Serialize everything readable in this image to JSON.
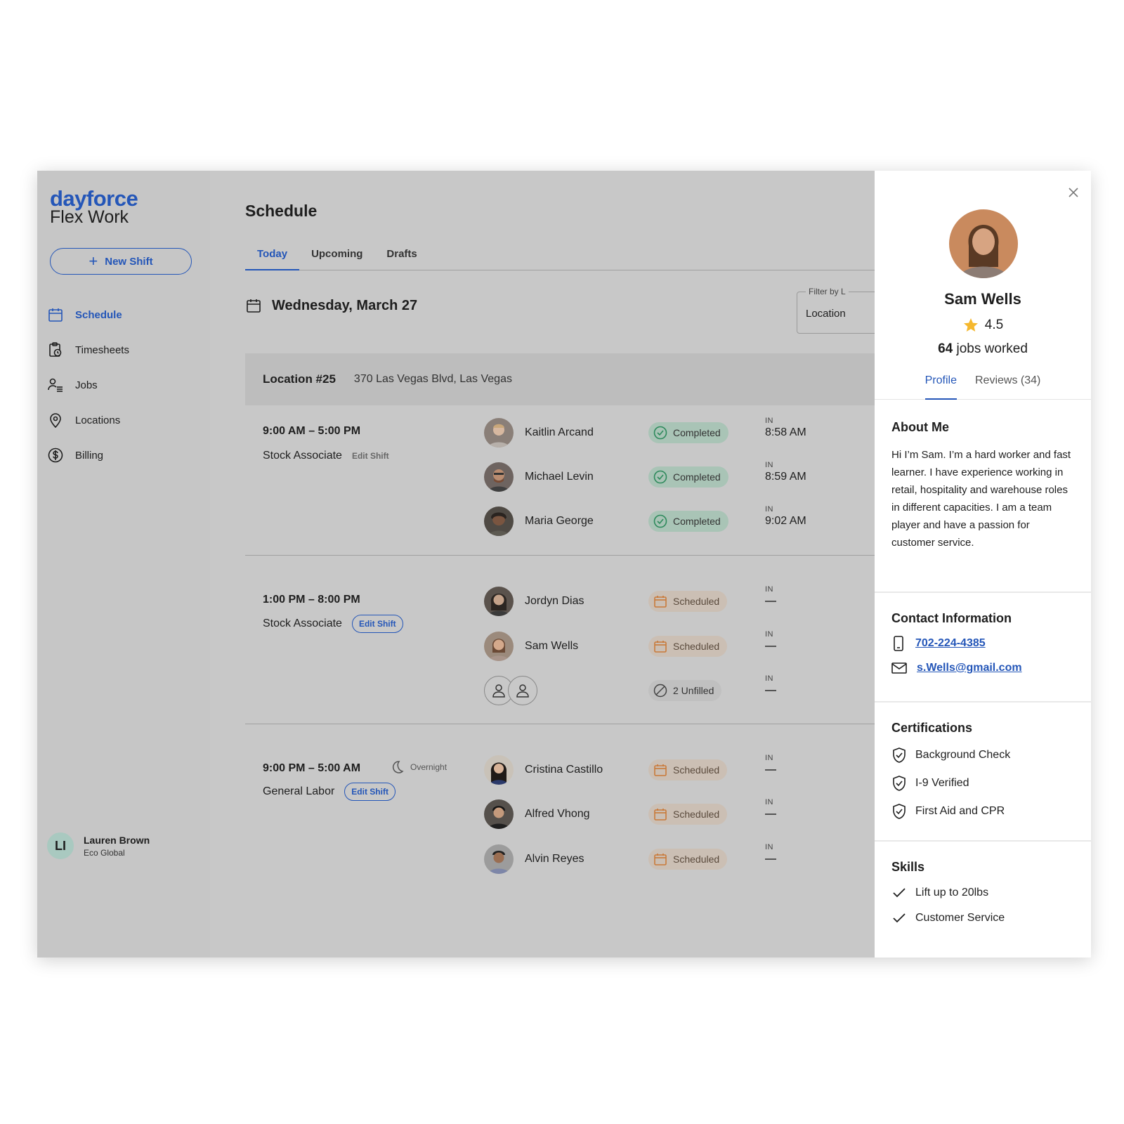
{
  "brand": {
    "top": "dayforce",
    "bottom": "Flex Work"
  },
  "new_shift_label": "New Shift",
  "nav": [
    {
      "label": "Schedule",
      "icon": "calendar-icon",
      "active": true
    },
    {
      "label": "Timesheets",
      "icon": "timesheet-icon",
      "active": false
    },
    {
      "label": "Jobs",
      "icon": "jobs-icon",
      "active": false
    },
    {
      "label": "Locations",
      "icon": "location-pin-icon",
      "active": false
    },
    {
      "label": "Billing",
      "icon": "dollar-icon",
      "active": false
    }
  ],
  "user": {
    "initials": "LI",
    "name": "Lauren Brown",
    "org": "Eco Global"
  },
  "page_title": "Schedule",
  "tabs": [
    "Today",
    "Upcoming",
    "Drafts"
  ],
  "date": "Wednesday, March 27",
  "filter": {
    "label": "Filter by L",
    "value": "Location"
  },
  "location": {
    "name": "Location #25",
    "address": "370 Las Vegas Blvd, Las Vegas"
  },
  "shifts": [
    {
      "time": "9:00 AM – 5:00 PM",
      "role": "Stock Associate",
      "edit_label": "Edit Shift",
      "workers": [
        {
          "name": "Kaitlin Arcand",
          "status": "Completed",
          "in_label": "IN",
          "in_time": "8:58 AM"
        },
        {
          "name": "Michael Levin",
          "status": "Completed",
          "in_label": "IN",
          "in_time": "8:59 AM"
        },
        {
          "name": "Maria George",
          "status": "Completed",
          "in_label": "IN",
          "in_time": "9:02 AM"
        }
      ]
    },
    {
      "time": "1:00 PM – 8:00 PM",
      "role": "Stock Associate",
      "edit_label": "Edit Shift",
      "workers": [
        {
          "name": "Jordyn Dias",
          "status": "Scheduled",
          "in_label": "IN",
          "in_time": ""
        },
        {
          "name": "Sam Wells",
          "status": "Scheduled",
          "in_label": "IN",
          "in_time": ""
        },
        {
          "name": "",
          "status": "2 Unfilled",
          "in_label": "IN",
          "in_time": ""
        }
      ]
    },
    {
      "time": "9:00 PM – 5:00 AM",
      "role": "General Labor",
      "edit_label": "Edit Shift",
      "overnight": "Overnight",
      "workers": [
        {
          "name": "Cristina Castillo",
          "status": "Scheduled",
          "in_label": "IN",
          "in_time": ""
        },
        {
          "name": "Alfred Vhong",
          "status": "Scheduled",
          "in_label": "IN",
          "in_time": ""
        },
        {
          "name": "Alvin Reyes",
          "status": "Scheduled",
          "in_label": "IN",
          "in_time": ""
        }
      ]
    }
  ],
  "profile": {
    "name": "Sam Wells",
    "rating": "4.5",
    "jobs_count": "64",
    "jobs_suffix": "jobs worked",
    "tabs": [
      "Profile",
      "Reviews (34)"
    ],
    "about_title": "About Me",
    "about_text": "Hi I’m Sam. I’m a hard worker and fast learner. I have experience working in retail, hospitality and warehouse roles in different capacities. I am a team player and have a passion for customer service.",
    "contact_title": "Contact Information",
    "phone": "702-224-4385",
    "email": "s.Wells@gmail.com",
    "cert_title": "Certifications",
    "certs": [
      "Background Check",
      "I-9 Verified",
      "First Aid and CPR"
    ],
    "skills_title": "Skills",
    "skills": [
      "Lift up to 20lbs",
      "Customer Service"
    ]
  },
  "colors": {
    "brand": "#2456b8",
    "completed": "#2e8a5c",
    "scheduled": "#c97a3a",
    "dim_overlay": "#c8c8c8"
  }
}
